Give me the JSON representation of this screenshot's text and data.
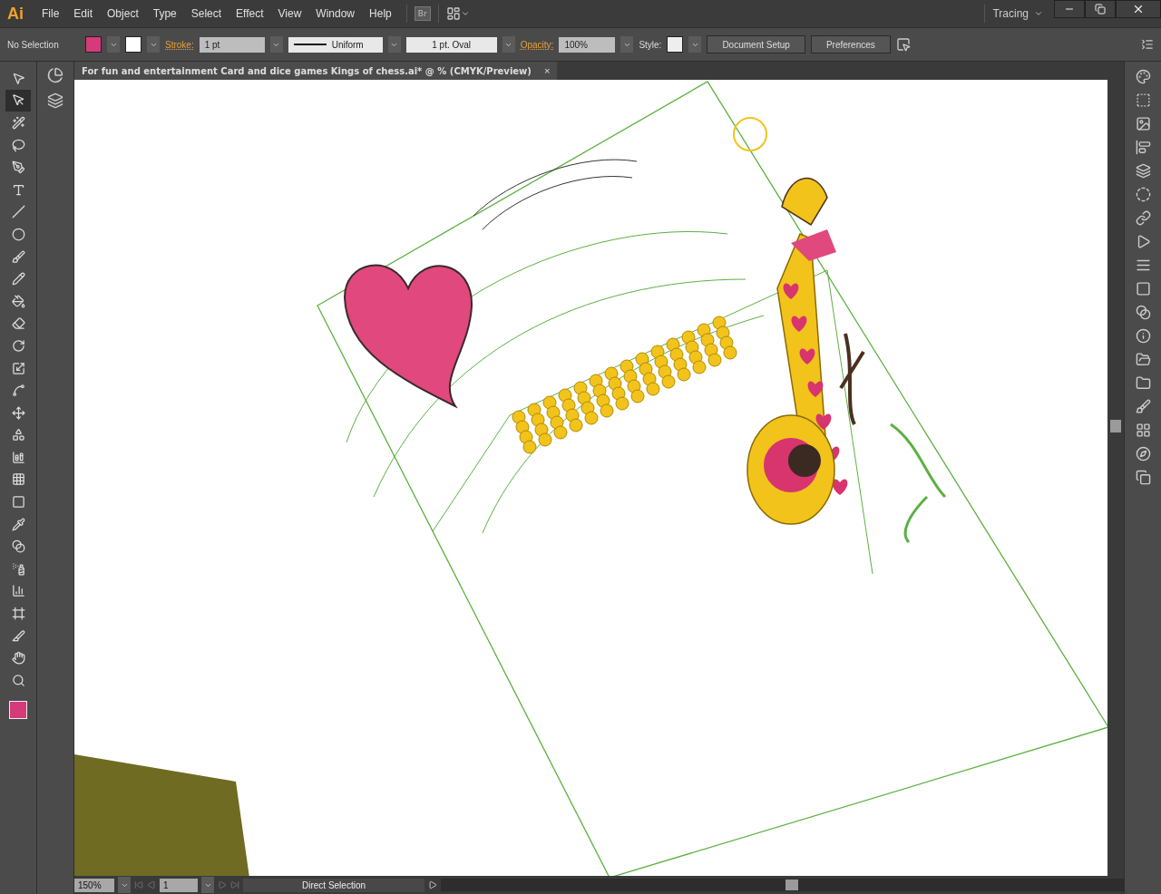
{
  "app": {
    "logo": "Ai",
    "menu": [
      "File",
      "Edit",
      "Object",
      "Type",
      "Select",
      "Effect",
      "View",
      "Window",
      "Help"
    ],
    "bridge": "Br",
    "workspace": "Tracing"
  },
  "control_bar": {
    "selection": "No Selection",
    "stroke_label": "Stroke:",
    "stroke_weight": "1 pt",
    "profile": "Uniform",
    "brush": "1 pt. Oval",
    "opacity_label": "Opacity:",
    "opacity": "100%",
    "style_label": "Style:",
    "buttons": [
      "Document Setup",
      "Preferences"
    ]
  },
  "document_tab": {
    "title": "For fun and entertainment Card and dice games Kings of chess.ai* @ % (CMYK/Preview)",
    "close": "×"
  },
  "tools": [
    {
      "selected": false
    },
    {
      "selected": true
    },
    {
      "selected": false
    },
    {
      "selected": false
    },
    {
      "selected": false
    },
    {
      "selected": false
    },
    {
      "selected": false
    },
    {
      "selected": false
    },
    {
      "selected": false
    },
    {
      "selected": false
    },
    {
      "selected": false
    },
    {
      "selected": false
    },
    {
      "selected": false
    },
    {
      "selected": false
    },
    {
      "selected": false
    },
    {
      "selected": false
    },
    {
      "selected": false
    },
    {
      "selected": false
    },
    {
      "selected": false
    },
    {
      "selected": false
    },
    {
      "selected": false
    },
    {
      "selected": false
    },
    {
      "selected": false
    },
    {
      "selected": false
    },
    {
      "selected": false
    },
    {
      "selected": false
    },
    {
      "selected": false
    },
    {
      "selected": false
    }
  ],
  "status_bar": {
    "zoom": "150%",
    "artboard": "1",
    "current_tool": "Direct Selection"
  }
}
